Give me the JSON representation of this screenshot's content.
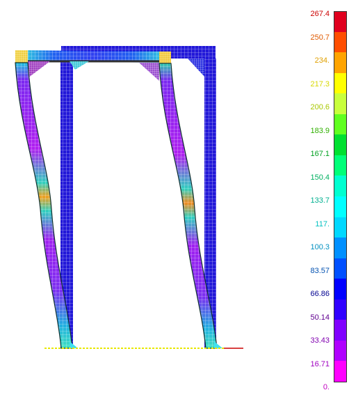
{
  "legend": {
    "colors": [
      "#e0001f",
      "#ff4e00",
      "#ffa400",
      "#ffff00",
      "#c8ff3c",
      "#60ff20",
      "#00e030",
      "#00ff78",
      "#00ffd0",
      "#00ffff",
      "#00d8ff",
      "#0090ff",
      "#0050ff",
      "#0000ff",
      "#3000ff",
      "#8000ff",
      "#b000ff",
      "#ff00ff"
    ],
    "labels": [
      {
        "text": "267.4",
        "color": "#cc0000"
      },
      {
        "text": "250.7",
        "color": "#e05a00"
      },
      {
        "text": "234.",
        "color": "#e0a000"
      },
      {
        "text": "217.3",
        "color": "#d8d800"
      },
      {
        "text": "200.6",
        "color": "#a8c800"
      },
      {
        "text": "183.9",
        "color": "#30b000"
      },
      {
        "text": "167.1",
        "color": "#00a020"
      },
      {
        "text": "150.4",
        "color": "#00b060"
      },
      {
        "text": "133.7",
        "color": "#00b090"
      },
      {
        "text": "117.",
        "color": "#00c0c0"
      },
      {
        "text": "100.3",
        "color": "#0090c0"
      },
      {
        "text": "83.57",
        "color": "#0050b0"
      },
      {
        "text": "66.86",
        "color": "#000090"
      },
      {
        "text": "50.14",
        "color": "#600090"
      },
      {
        "text": "33.43",
        "color": "#8000b0"
      },
      {
        "text": "16.71",
        "color": "#a000c0"
      },
      {
        "text": "0.",
        "color": "#c000c0"
      }
    ]
  },
  "model": {
    "colors": {
      "outer_frame": "#2218d8",
      "mesh_line": "#ffffff",
      "column_low": "#9a1cf0",
      "column_mid": "#22d8e8",
      "column_peak": "#f08a20",
      "joint": "#f0d040",
      "gusset": "#a040c0",
      "ground": "#e8e800",
      "ground_right": "#cc0000"
    }
  }
}
